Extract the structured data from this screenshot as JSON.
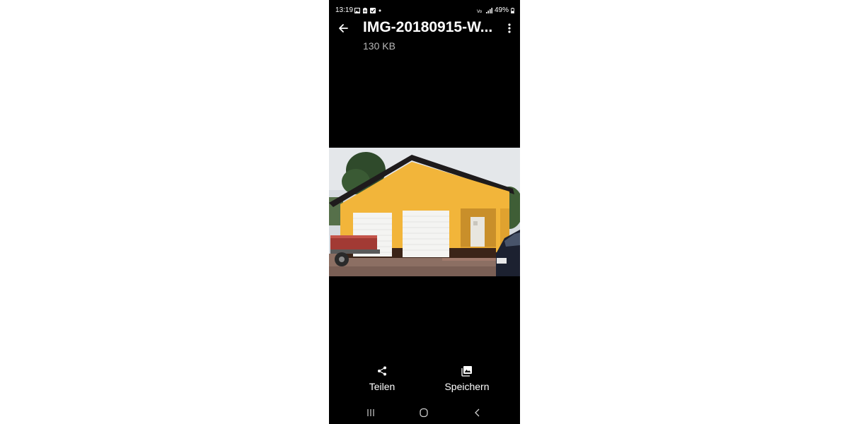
{
  "status_bar": {
    "time": "13:19",
    "battery": "49%",
    "icons": [
      "image-icon",
      "clipboard-icon",
      "check-icon",
      "dot-icon"
    ],
    "right_icons": [
      "volte-icon",
      "signal-icon",
      "battery-icon"
    ]
  },
  "header": {
    "title": "IMG-20180915-W...",
    "file_size": "130 KB",
    "back_icon": "arrow-left-icon",
    "menu_icon": "more-vertical-icon"
  },
  "viewer": {
    "subject": "yellow garage with two white roll-up doors"
  },
  "actions": [
    {
      "label": "Teilen",
      "icon": "share-icon"
    },
    {
      "label": "Speichern",
      "icon": "gallery-save-icon"
    }
  ],
  "nav": {
    "recents_icon": "recents-icon",
    "home_icon": "home-icon",
    "back_icon": "nav-back-icon"
  },
  "colors": {
    "background": "#000000",
    "text": "#ffffff",
    "secondary_text": "#b8b8b8",
    "wall": "#f2b53a"
  }
}
